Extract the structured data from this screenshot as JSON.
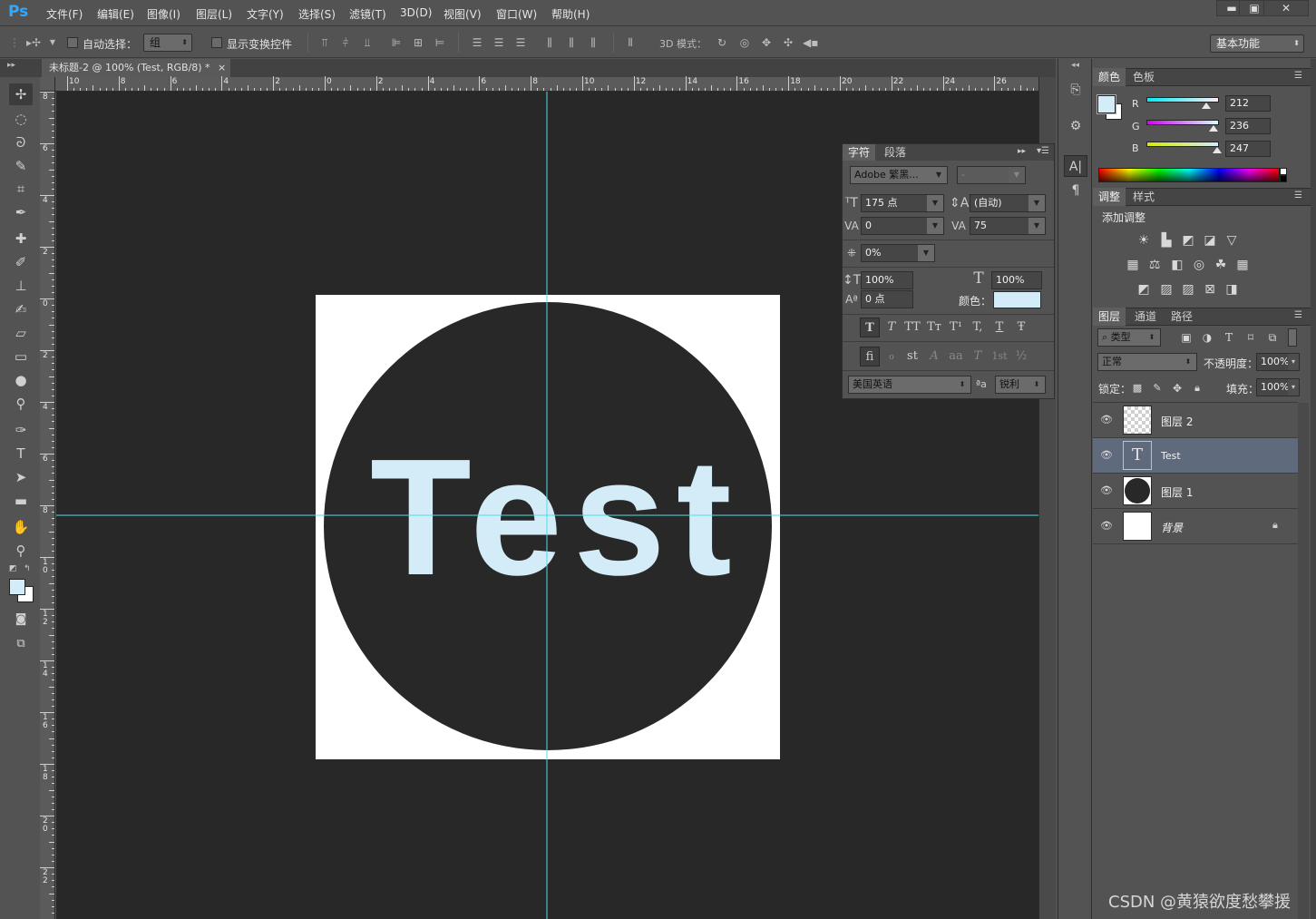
{
  "app": {
    "logo": "Ps"
  },
  "menu": [
    "文件(F)",
    "编辑(E)",
    "图像(I)",
    "图层(L)",
    "文字(Y)",
    "选择(S)",
    "滤镜(T)",
    "3D(D)",
    "视图(V)",
    "窗口(W)",
    "帮助(H)"
  ],
  "window_controls": {
    "minimize": "▬",
    "restore": "▣",
    "close": "✕"
  },
  "options_bar": {
    "auto_select_label": "自动选择：",
    "auto_select_value": "组",
    "show_transform_label": "显示变换控件",
    "mode_3d_label": "3D 模式：",
    "workspace": "基本功能"
  },
  "document": {
    "tab_title": "未标题-2 @ 100% (Test, RGB/8) *",
    "tab_close": "×",
    "canvas_text": "Test",
    "text_color": "#d4ecf7",
    "circle_color": "#282828",
    "guide_color": "#4de0e8",
    "ruler_top_labels": [
      "10",
      "8",
      "6",
      "4",
      "2",
      "0",
      "2",
      "4",
      "6",
      "8",
      "10",
      "12",
      "14",
      "16",
      "18",
      "20",
      "22",
      "24",
      "26"
    ],
    "ruler_left_labels": [
      "8",
      "6",
      "4",
      "2",
      "0",
      "2",
      "4",
      "6",
      "8",
      "1\n0",
      "1\n2",
      "1\n4",
      "1\n6",
      "1\n8",
      "2\n0",
      "2\n2"
    ]
  },
  "character_panel": {
    "tabs": [
      "字符",
      "段落"
    ],
    "font_family": "Adobe 繁黑...",
    "font_style": "-",
    "font_size": "175 点",
    "leading": "(自动)",
    "kerning": "0",
    "tracking": "75",
    "tsume": "0%",
    "vertical_scale": "100%",
    "horizontal_scale": "100%",
    "baseline_shift": "0 点",
    "color_label": "颜色：",
    "color": "#d4ecf7",
    "style_buttons": [
      "T",
      "T",
      "TT",
      "Tт",
      "T¹",
      "T,",
      "T",
      "Ŧ"
    ],
    "opentype_buttons": [
      "ﬁ",
      "ℴ",
      "st",
      "A",
      "aa",
      "T",
      "1st",
      "½"
    ],
    "language": "美国英语",
    "aa_label": "ªa",
    "antialias": "锐利"
  },
  "color_panel": {
    "tabs": [
      "颜色",
      "色板"
    ],
    "r_label": "R",
    "g_label": "G",
    "b_label": "B",
    "r": "212",
    "g": "236",
    "b": "247",
    "r_level": 0.83,
    "g_level": 0.93,
    "b_level": 0.97,
    "foreground": "#d4ecf7",
    "background": "#ffffff"
  },
  "adjustments_panel": {
    "tabs": [
      "调整",
      "样式"
    ],
    "title": "添加调整"
  },
  "layers_panel": {
    "tabs": [
      "图层",
      "通道",
      "路径"
    ],
    "filter_kind": "类型",
    "blend_mode": "正常",
    "opacity_label": "不透明度：",
    "opacity": "100%",
    "lock_label": "锁定：",
    "fill_label": "填充：",
    "fill": "100%",
    "layers": [
      {
        "name": "图层 2",
        "type": "transparent",
        "selected": false
      },
      {
        "name": "Test",
        "type": "text",
        "selected": true
      },
      {
        "name": "图层 1",
        "type": "circle",
        "selected": false
      },
      {
        "name": "背景",
        "type": "background",
        "selected": false,
        "locked": true
      }
    ]
  },
  "watermark": "CSDN @黄猿欲度愁攀援"
}
